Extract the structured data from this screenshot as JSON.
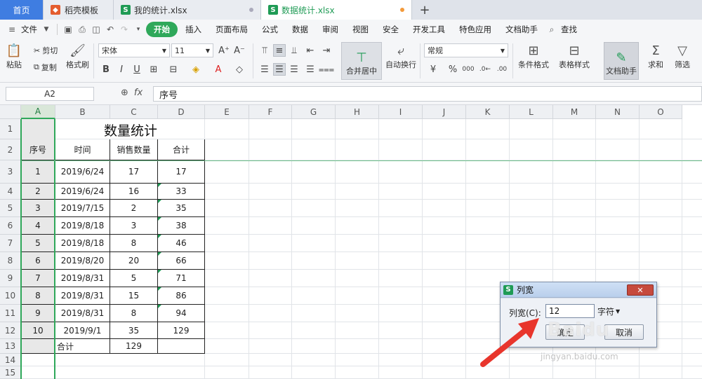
{
  "tabs": [
    {
      "label": "首页"
    },
    {
      "label": "稻壳模板"
    },
    {
      "label": "我的统计.xlsx"
    },
    {
      "label": "数据统计.xlsx"
    }
  ],
  "menu": {
    "file": "文件",
    "items": [
      "开始",
      "插入",
      "页面布局",
      "公式",
      "数据",
      "审阅",
      "视图",
      "安全",
      "开发工具",
      "特色应用",
      "文档助手"
    ],
    "search": "查找"
  },
  "ribbon": {
    "paste": "粘贴",
    "cut": "剪切",
    "copy": "复制",
    "format_painter": "格式刷",
    "font_name": "宋体",
    "font_size": "11",
    "merge_center": "合并居中",
    "wrap_text": "自动换行",
    "number_format": "常规",
    "conditional_format": "条件格式",
    "table_style": "表格样式",
    "doc_assistant": "文档助手",
    "sum": "求和",
    "filter": "筛选"
  },
  "formula_bar": {
    "cell_ref": "A2",
    "value": "序号"
  },
  "columns": [
    "A",
    "B",
    "C",
    "D",
    "E",
    "F",
    "G",
    "H",
    "I",
    "J",
    "K",
    "L",
    "M",
    "N",
    "O"
  ],
  "rows": [
    "1",
    "2",
    "3",
    "4",
    "5",
    "6",
    "7",
    "8",
    "9",
    "10",
    "11",
    "12",
    "13",
    "14",
    "15"
  ],
  "sheet": {
    "title": "数量统计",
    "headers": [
      "序号",
      "时间",
      "销售数量",
      "合计"
    ],
    "data": [
      [
        "1",
        "2019/6/24",
        "17",
        "17"
      ],
      [
        "2",
        "2019/6/24",
        "16",
        "33"
      ],
      [
        "3",
        "2019/7/15",
        "2",
        "35"
      ],
      [
        "4",
        "2019/8/18",
        "3",
        "38"
      ],
      [
        "5",
        "2019/8/18",
        "8",
        "46"
      ],
      [
        "6",
        "2019/8/20",
        "20",
        "66"
      ],
      [
        "7",
        "2019/8/31",
        "5",
        "71"
      ],
      [
        "8",
        "2019/8/31",
        "15",
        "86"
      ],
      [
        "9",
        "2019/8/31",
        "8",
        "94"
      ],
      [
        "10",
        "2019/9/1",
        "35",
        "129"
      ]
    ],
    "total_label": "合计",
    "total_value": "129"
  },
  "dialog": {
    "title": "列宽",
    "label": "列宽(C):",
    "value": "12",
    "unit": "字符",
    "ok": "确定",
    "cancel": "取消"
  },
  "watermark": {
    "text": "Baidu",
    "url": "jingyan.baidu.com"
  },
  "colors": {
    "accent_green": "#2fa85a",
    "home_tab_blue": "#3f7de1",
    "arrow_red": "#e8352c"
  }
}
